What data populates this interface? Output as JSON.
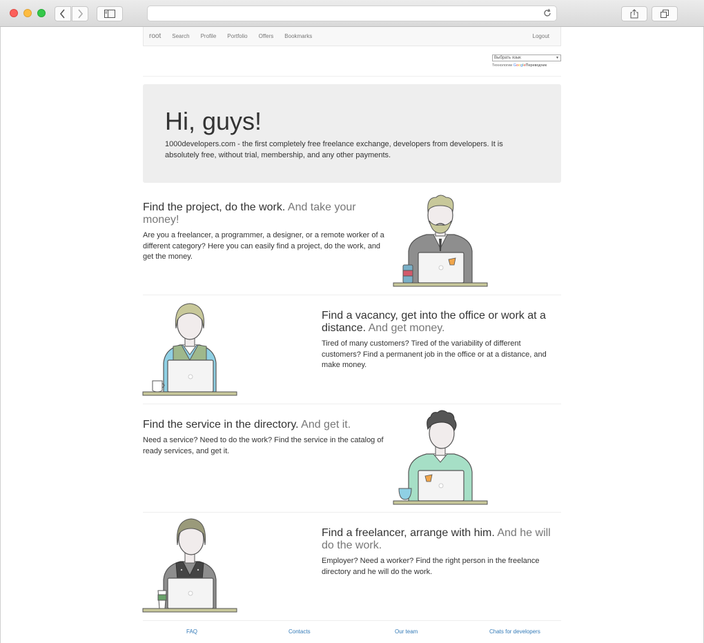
{
  "browser": {
    "address": ""
  },
  "nav": {
    "brand": "root",
    "items": [
      "Search",
      "Profile",
      "Portfolio",
      "Offers",
      "Bookmarks"
    ],
    "logout": "Logout"
  },
  "translate": {
    "select_label": "Выбрать язык",
    "credit_prefix": "Технологии",
    "credit_google": [
      "G",
      "o",
      "o",
      "g",
      "l",
      "e"
    ],
    "credit_suffix": "Переводчик"
  },
  "jumbotron": {
    "title": "Hi, guys!",
    "text": "1000developers.com - the first completely free freelance exchange, developers from developers. It is absolutely free, without trial, membership, and any other payments."
  },
  "features": [
    {
      "heading": "Find the project, do the work.",
      "muted": "And take your money!",
      "text": "Are you a freelancer, a programmer, a designer, or a remote worker of a different category? Here you can easily find a project, do the work, and get the money."
    },
    {
      "heading": "Find a vacancy, get into the office or work at a distance.",
      "muted": "And get money.",
      "text": "Tired of many customers? Tired of the variability of different customers? Find a permanent job in the office or at a distance, and make money."
    },
    {
      "heading": "Find the service in the directory.",
      "muted": "And get it.",
      "text": "Need a service? Need to do the work? Find the service in the catalog of ready services, and get it."
    },
    {
      "heading": "Find a freelancer, arrange with him.",
      "muted": "And he will do the work.",
      "text": "Employer? Need a worker? Find the right person in the freelance directory and he will do the work."
    }
  ],
  "footer": {
    "links": [
      "FAQ",
      "Contacts",
      "Our team",
      "Chats for developers"
    ]
  },
  "colors": {
    "link": "#337ab7",
    "jumbotron_bg": "#eeeeee",
    "navbar_bg": "#f8f8f8"
  }
}
